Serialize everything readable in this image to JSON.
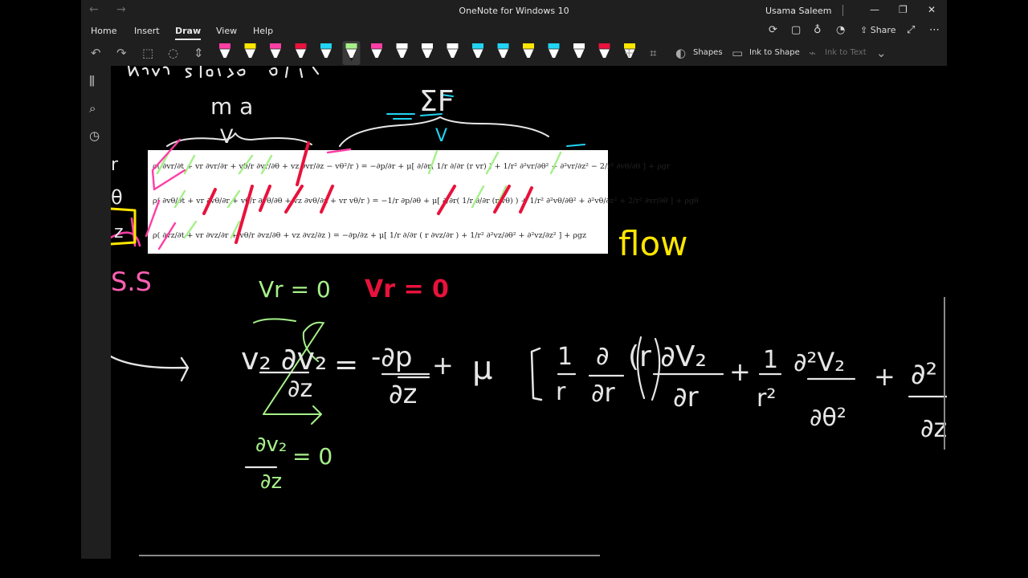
{
  "window": {
    "title": "OneNote for Windows 10",
    "user": "Usama Saleem",
    "controls": [
      "—",
      "❐",
      "✕"
    ],
    "nav_back": "←",
    "nav_forward": "→"
  },
  "ribbon": {
    "tabs": [
      "Home",
      "Insert",
      "Draw",
      "View",
      "Help"
    ],
    "active_tab": "Draw",
    "share_label": "Share"
  },
  "toolbar": {
    "shapes_label": "Shapes",
    "ink_to_shape_label": "Ink to Shape",
    "ink_to_text_label": "Ink to Text",
    "pen_colors": [
      "#ff3ea5",
      "#ffe600",
      "#ff3ea5",
      "#e8123c",
      "#21d4f3",
      "#a6f08a",
      "#ff3ea5",
      "#ffffff",
      "#ffffff",
      "#ffffff",
      "#21d4f3",
      "#21d4f3",
      "#ffe600",
      "#21d4f3",
      "#ffffff",
      "#e8123c",
      "#ffe600",
      "#21d4f3"
    ]
  },
  "canvas": {
    "title_partial": "Navier-Stokes Eqns",
    "ma_label": "m a",
    "ma_sub": "V",
    "sumF_label": "ΣF",
    "sumF_sub": "V",
    "left_theta": "θ",
    "left_r": "r",
    "left_z": "z",
    "ss_label": "S.S",
    "flow_label": "flow",
    "vr_green": "Vr = 0",
    "vr_red": "Vr = 0",
    "dvz_dz_top": "∂v₂",
    "dvz_dz_bottom": "∂z",
    "dvz_dz_eq": "= 0",
    "main_eq": {
      "lhs_top": "v₂ ∂v₂",
      "lhs_bottom": "∂z",
      "eq": "=",
      "p_top": "-∂p",
      "p_bottom": "∂z",
      "plus1": "+",
      "mu": "μ",
      "bracket": "[",
      "one_r_top": "1",
      "one_r_bottom": "r",
      "d_top": "∂",
      "d_bottom": "∂r",
      "r_term": "(r ∂V₂",
      "r_term_bottom": "∂r",
      "close_paren": ")",
      "plus2": "+",
      "one_r2_top": "1",
      "one_r2_bottom": "r²",
      "d2_top": "∂²V₂",
      "d2_bottom": "∂θ²",
      "plus3": "+",
      "last_top": "∂²",
      "last_bottom": "∂z"
    }
  },
  "equations": {
    "r_row": "ρ( ∂vr/∂t + vr ∂vr/∂r + vθ/r ∂vr/∂θ + vz ∂vr/∂z − vθ²/r ) = −∂p/∂r + μ[ ∂/∂r( 1/r ∂/∂r (r vr) ) + 1/r² ∂²vr/∂θ² + ∂²vr/∂z² − 2/r² ∂vθ/∂θ ] + ρgr",
    "theta_row": "ρ( ∂vθ/∂t + vr ∂vθ/∂r + vθ/r ∂vθ/∂θ + vz ∂vθ/∂z + vr vθ/r ) = −1/r ∂p/∂θ + μ[ ∂/∂r( 1/r ∂/∂r (r vθ) ) + 1/r² ∂²vθ/∂θ² + ∂²vθ/∂z² + 2/r² ∂vr/∂θ ] + ρgθ",
    "z_row": "ρ( ∂vz/∂t + vr ∂vz/∂r + vθ/r ∂vz/∂θ + vz ∂vz/∂z ) = −∂p/∂z + μ[ 1/r ∂/∂r ( r ∂vz/∂r ) + 1/r² ∂²vz/∂θ² + ∂²vz/∂z² ] + ρgz"
  }
}
